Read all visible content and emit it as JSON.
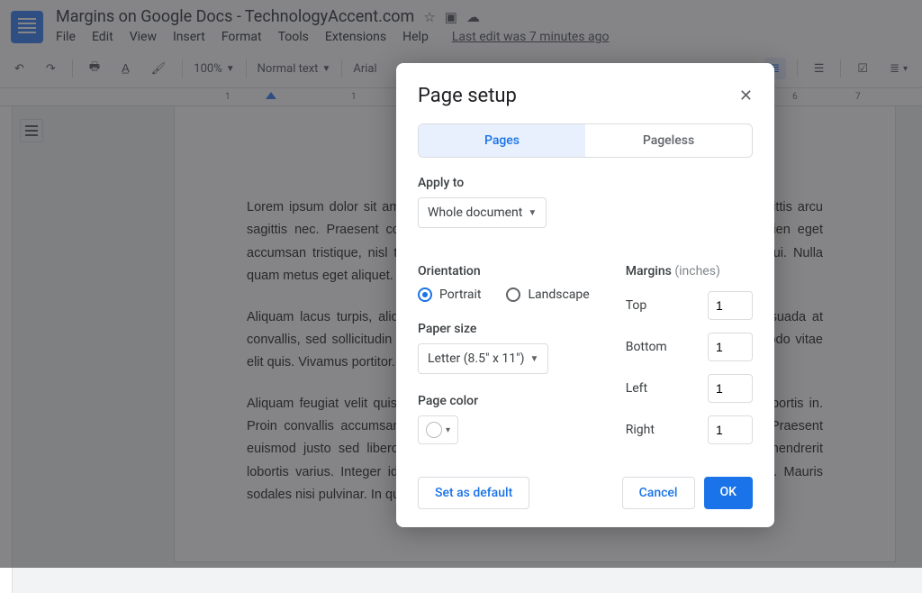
{
  "header": {
    "title": "Margins on Google Docs - TechnologyAccent.com",
    "menus": [
      "File",
      "Edit",
      "View",
      "Insert",
      "Format",
      "Tools",
      "Extensions",
      "Help"
    ],
    "last_edit": "Last edit was 7 minutes ago"
  },
  "toolbar": {
    "zoom": "100%",
    "style": "Normal text",
    "font": "Arial"
  },
  "document": {
    "paragraphs": [
      "Lorem ipsum dolor sit amet, consectetur adipiscing elit. Donec id magna ipsum, vel sagittis arcu sagittis nec. Praesent commodo neque et suscipit. Maecenas ac magna viverra, sapien eget accumsan tristique, nisl tortor pretium justo, sit amet ullamcorper fringilla metus quis dui. Nulla quam metus eget aliquet. Maximus metus, et fermentum.",
      "Aliquam lacus turpis, aliquet ac lacus eget, facilisis laoreet ligula. Sed mi lectus, malesuada at convallis, sed sollicitudin erat. Donec ultrices quam, at fermentum nisl. Phasellus commodo vitae elit quis. Vivamus portitor. Nulla eu turpis porttitor, sed molestie.",
      "Aliquam feugiat velit quis feugiat congue. Nulla et eleifend sapien. Cras efficitur nibh lobortis in. Proin convallis accumsan diam, non pellentesque tellus. Integer eget pulvinar quam. Praesent euismod justo sed libero, sit amet interdum urna consequat. In condimentum lacus hendrerit lobortis varius. Integer id tempus in aliquam hendrerit, fringilla convallis lectus gravida. Mauris sodales nisi pulvinar. In quis ullamcorper augue."
    ]
  },
  "dialog": {
    "title": "Page setup",
    "tabs": {
      "pages": "Pages",
      "pageless": "Pageless"
    },
    "apply_to_label": "Apply to",
    "apply_to_value": "Whole document",
    "orientation_label": "Orientation",
    "orientation": {
      "portrait": "Portrait",
      "landscape": "Landscape"
    },
    "paper_size_label": "Paper size",
    "paper_size_value": "Letter (8.5\" x 11\")",
    "page_color_label": "Page color",
    "margins_label": "Margins",
    "margins_unit": "(inches)",
    "margins": {
      "top_label": "Top",
      "top_value": "1",
      "bottom_label": "Bottom",
      "bottom_value": "1",
      "left_label": "Left",
      "left_value": "1",
      "right_label": "Right",
      "right_value": "1"
    },
    "buttons": {
      "default": "Set as default",
      "cancel": "Cancel",
      "ok": "OK"
    }
  }
}
